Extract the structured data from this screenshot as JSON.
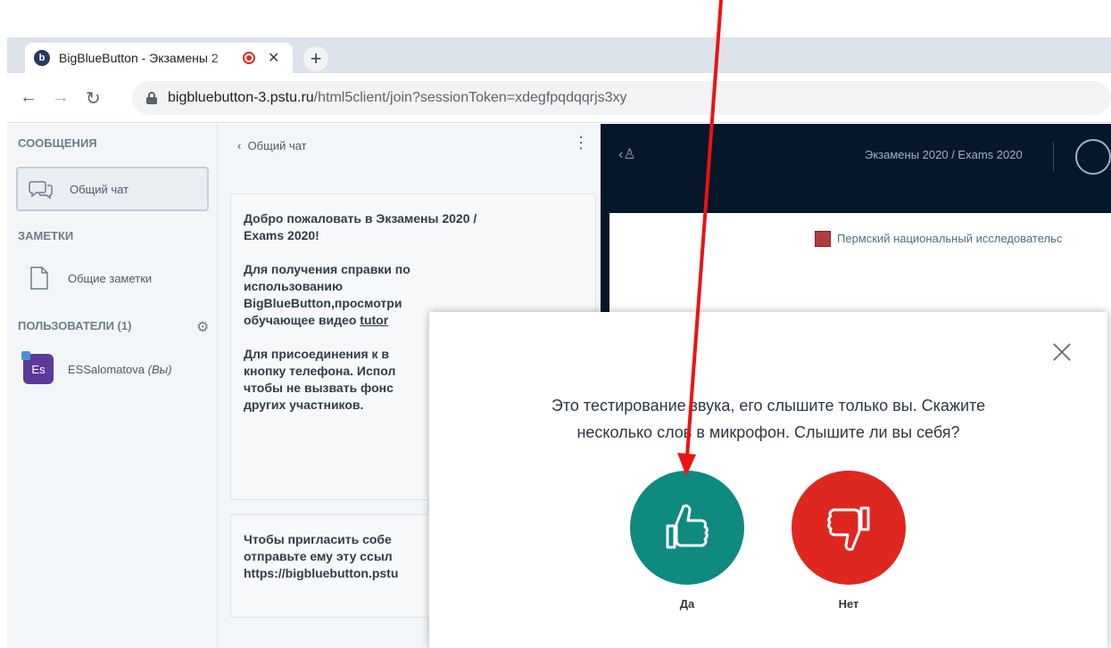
{
  "browser": {
    "tab_title": "BigBlueButton - Экзамены 2",
    "url_host": "bigbluebutton-3.pstu.ru",
    "url_path": "/html5client/join?sessionToken=xdegfpqdqqrjs3xy"
  },
  "sidebar": {
    "messages_heading": "СООБЩЕНИЯ",
    "public_chat_label": "Общий чат",
    "notes_heading": "ЗАМЕТКИ",
    "shared_notes_label": "Общие заметки",
    "users_heading": "ПОЛЬЗОВАТЕЛИ (1)",
    "user": {
      "initials": "Es",
      "name": "ESSalomatova",
      "you_tag": "(Вы)"
    }
  },
  "chat": {
    "header": "Общий чат",
    "welcome": {
      "line1": "Добро пожаловать в Экзамены 2020 /",
      "line2": "Exams 2020!",
      "help1": "Для получения справки по",
      "help2": "использованию",
      "help3": "BigBlueButton,просмотри",
      "help4_pre": "обучающее видео ",
      "help4_link": "tutor",
      "join1": "Для присоединения к в",
      "join2": "кнопку телефона. Испол",
      "join3": "чтобы не вызвать фонс",
      "join4": "других участников."
    },
    "invite": {
      "line1": "Чтобы пригласить собе",
      "line2": "отправьте ему эту ссыл",
      "line3": "https://bigbluebutton.pstu"
    }
  },
  "main": {
    "meeting_title": "Экзамены 2020 / Exams 2020",
    "slide_caption": "Пермский национальный исследовательс"
  },
  "modal": {
    "line1": "Это тестирование звука, его слышите только вы. Скажите",
    "line2": "несколько слов в микрофон. Слышите ли вы себя?",
    "yes_label": "Да",
    "no_label": "Нет"
  },
  "colors": {
    "yes_button": "#0f8a7e",
    "no_button": "#df2721",
    "annotation_arrow": "#ee1111",
    "meeting_header": "#06172a"
  }
}
